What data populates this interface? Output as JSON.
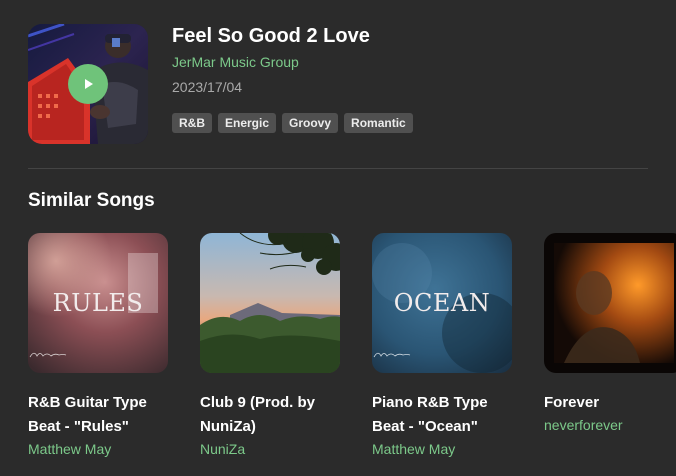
{
  "track": {
    "title": "Feel So Good 2 Love",
    "artist": "JerMar Music Group",
    "date": "2023/17/04",
    "tags": [
      "R&B",
      "Energic",
      "Groovy",
      "Romantic"
    ],
    "cover_icon": "play-icon"
  },
  "similar": {
    "heading": "Similar Songs",
    "songs": [
      {
        "title": "R&B Guitar Type Beat - \"Rules\"",
        "artist": "Matthew May",
        "art_text": "RULES",
        "art_signature": "Matthew May"
      },
      {
        "title": "Club 9 (Prod. by NuniZa)",
        "artist": "NuniZa"
      },
      {
        "title": "Piano R&B Type Beat - \"Ocean\"",
        "artist": "Matthew May",
        "art_text": "OCEAN",
        "art_signature": "Matthew May"
      },
      {
        "title": "Forever",
        "artist": "neverforever"
      }
    ]
  },
  "colors": {
    "background": "#2b2b2b",
    "accent": "#6fc37a",
    "artist_text": "#7cc98a",
    "tag_bg": "#505050"
  }
}
